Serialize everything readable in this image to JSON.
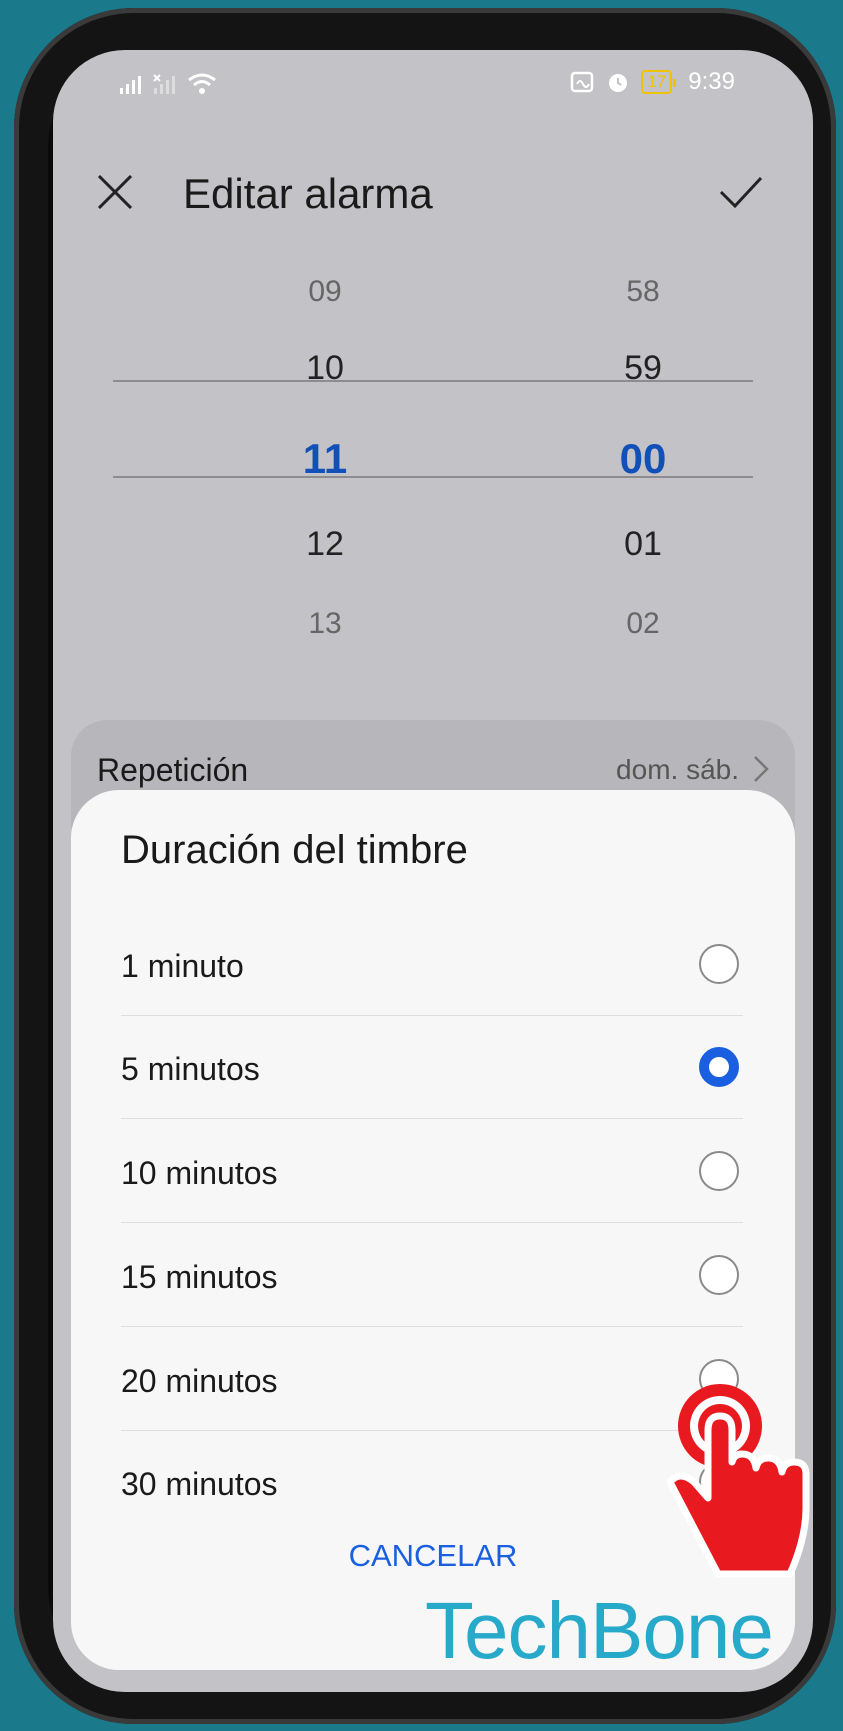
{
  "status_bar": {
    "signal_text": ".ıll",
    "battery": "17",
    "time": "9:39"
  },
  "header": {
    "title": "Editar alarma",
    "close_icon": "close-icon",
    "confirm_icon": "check-icon"
  },
  "time_picker": {
    "hours": [
      "09",
      "10",
      "11",
      "12",
      "13"
    ],
    "minutes": [
      "58",
      "59",
      "00",
      "01",
      "02"
    ],
    "selected_hour": "11",
    "selected_minute": "00"
  },
  "repetition": {
    "label": "Repetición",
    "value": "dom. sáb."
  },
  "ring_duration_sheet": {
    "title": "Duración del timbre",
    "options": [
      {
        "label": "1 minuto",
        "selected": false
      },
      {
        "label": "5 minutos",
        "selected": true
      },
      {
        "label": "10 minutos",
        "selected": false
      },
      {
        "label": "15 minutos",
        "selected": false
      },
      {
        "label": "20 minutos",
        "selected": false
      },
      {
        "label": "30 minutos",
        "selected": false
      }
    ],
    "cancel": "CANCELAR"
  },
  "watermark": "TechBone",
  "colors": {
    "accent": "#1a5fe0",
    "selected_picker": "#1150b8",
    "background": "#1a7a8c",
    "watermark": "#27a9c9",
    "tap_indicator": "#e8191f"
  }
}
